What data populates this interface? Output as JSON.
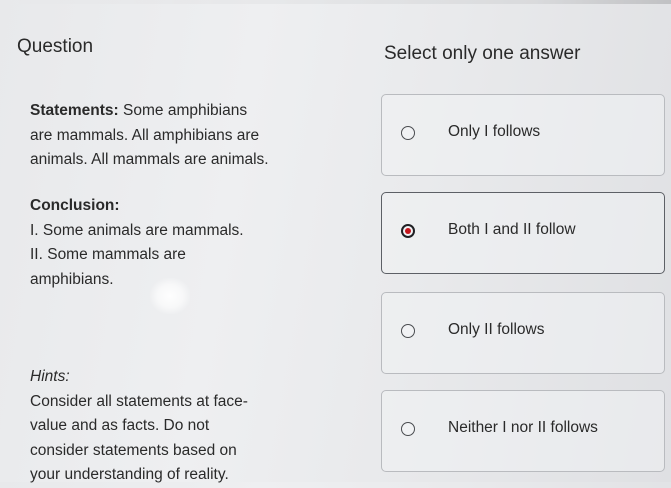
{
  "header": {
    "question_label": "Question",
    "instruction": "Select only one answer"
  },
  "statements": {
    "title": "Statements:",
    "line1": "Some amphibians",
    "line2": "are mammals. All amphibians are",
    "line3": "animals. All mammals are animals."
  },
  "conclusion": {
    "title": "Conclusion:",
    "line1": "I. Some animals are mammals.",
    "line2": "II. Some mammals are",
    "line3": "amphibians."
  },
  "hints": {
    "title": "Hints:",
    "line1": "Consider all statements at face-",
    "line2": "value and as facts. Do not",
    "line3": "consider statements based on",
    "line4": "your understanding of reality."
  },
  "options": [
    {
      "label": "Only I follows",
      "selected": false
    },
    {
      "label": "Both I and II follow",
      "selected": true
    },
    {
      "label": "Only II follows",
      "selected": false
    },
    {
      "label": "Neither I nor II follows",
      "selected": false
    }
  ],
  "colors": {
    "selected_dot": "#c4151c",
    "text": "#2a2a2a",
    "border": "#b9bbbf"
  }
}
